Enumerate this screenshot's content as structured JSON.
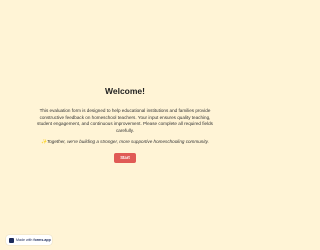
{
  "welcome": {
    "title": "Welcome!",
    "intro": "This evaluation form is designed to help educational institutions and families provide constructive feedback on homeschool teachers. Your input ensures quality teaching, student engagement, and continuous improvement. Please complete all required fields carefully.",
    "tagline": "✨Together, we're building a stronger, more supportive homeschooling community.",
    "start_label": "Start"
  },
  "badge": {
    "prefix": "Made with",
    "brand": "forms.app",
    "icon": "forms-app-logo-icon"
  },
  "colors": {
    "background": "#fff4d6",
    "button": "#e05a55",
    "badge_text": "#1c2b5a"
  }
}
